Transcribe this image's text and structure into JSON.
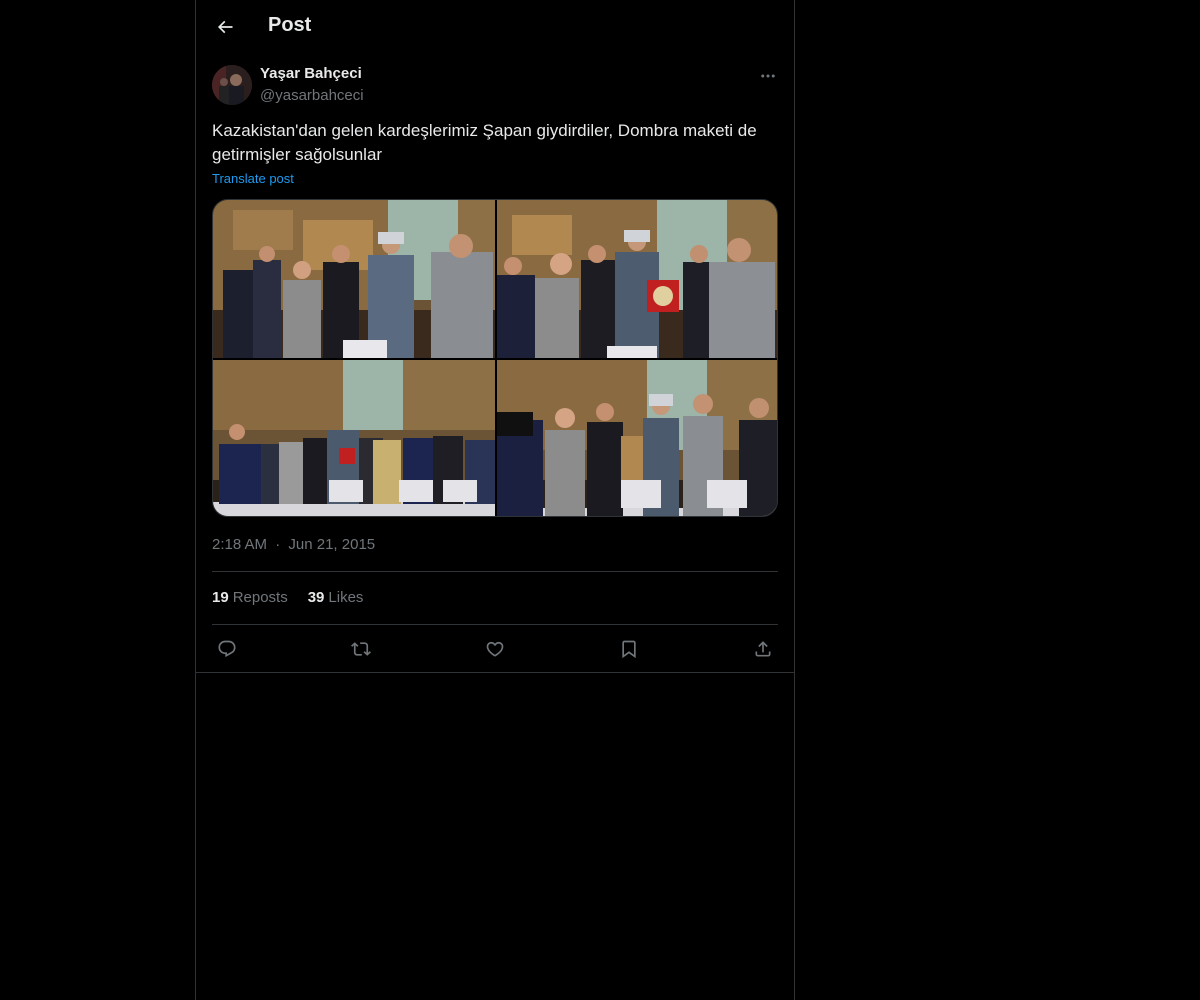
{
  "header": {
    "back_icon": "arrow-left-icon",
    "title": "Post"
  },
  "author": {
    "name": "Yaşar Bahçeci",
    "handle": "@yasarbahceci",
    "more_icon": "more-horizontal-icon"
  },
  "post": {
    "text": "Kazakistan'dan gelen kardeşlerimiz Şapan giydirdiler, Dombra maketi de getirmişler sağolsunlar",
    "translate_label": "Translate post",
    "photo_count": 4,
    "time": "2:18 AM",
    "separator": "·",
    "date": "Jun 21, 2015"
  },
  "stats": {
    "reposts_count": "19",
    "reposts_label": "Reposts",
    "likes_count": "39",
    "likes_label": "Likes"
  },
  "actions": {
    "reply_icon": "reply-icon",
    "repost_icon": "repost-icon",
    "like_icon": "heart-icon",
    "bookmark_icon": "bookmark-icon",
    "share_icon": "share-icon"
  },
  "colors": {
    "background": "#000000",
    "text": "#e7e9ea",
    "muted": "#71767b",
    "link": "#1d9bf0",
    "border": "#2f3336"
  }
}
